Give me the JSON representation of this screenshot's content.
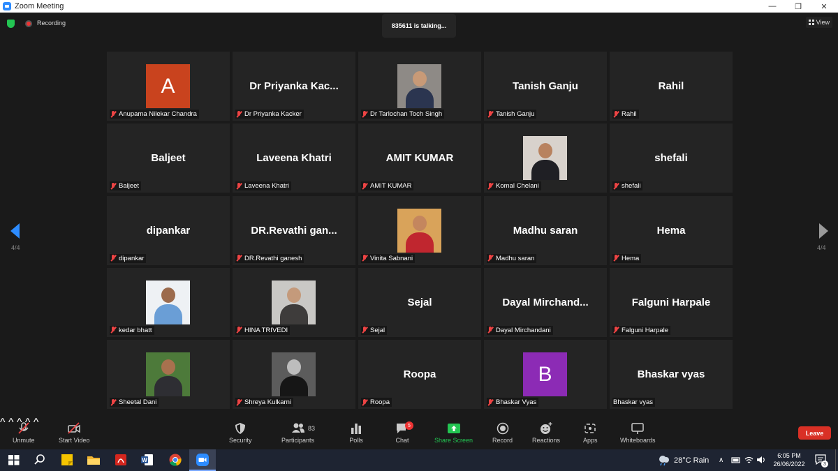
{
  "window": {
    "title": "Zoom Meeting",
    "minimize": "—",
    "restore": "❐",
    "close": "✕"
  },
  "topbar": {
    "recording_label": "Recording",
    "talking_text": "835611 is talking...",
    "view_label": "View"
  },
  "pagination": {
    "left_page": "4/4",
    "right_page": "4/4"
  },
  "participants": [
    {
      "tile": "",
      "label": "Anupama Nilekar Chandra",
      "avatar": "letter",
      "letter": "A",
      "color": "#c9431e",
      "muted": true
    },
    {
      "tile": "Dr Priyanka Kac...",
      "label": "Dr Priyanka Kacker",
      "avatar": "none",
      "muted": true
    },
    {
      "tile": "",
      "label": "Dr Tarlochan Toch Singh",
      "avatar": "photo",
      "bg": "#8e8a86",
      "skin": "#c89a77",
      "cloth": "#2b3550",
      "muted": true
    },
    {
      "tile": "Tanish Ganju",
      "label": "Tanish Ganju",
      "avatar": "none",
      "muted": true
    },
    {
      "tile": "Rahil",
      "label": "Rahil",
      "avatar": "none",
      "muted": true
    },
    {
      "tile": "Baljeet",
      "label": "Baljeet",
      "avatar": "none",
      "muted": true
    },
    {
      "tile": "Laveena Khatri",
      "label": "Laveena Khatri",
      "avatar": "none",
      "muted": true
    },
    {
      "tile": "AMIT KUMAR",
      "label": "AMIT KUMAR",
      "avatar": "none",
      "muted": true
    },
    {
      "tile": "",
      "label": "Komal Chelani",
      "avatar": "photo",
      "bg": "#d8d2cc",
      "skin": "#b8825f",
      "cloth": "#1f1f24",
      "muted": true
    },
    {
      "tile": "shefali",
      "label": "shefali",
      "avatar": "none",
      "muted": true
    },
    {
      "tile": "dipankar",
      "label": "dipankar",
      "avatar": "none",
      "muted": true
    },
    {
      "tile": "DR.Revathi  gan...",
      "label": "DR.Revathi ganesh",
      "avatar": "none",
      "muted": true
    },
    {
      "tile": "",
      "label": "Vinita Sabnani",
      "avatar": "photo",
      "bg": "#d9a35a",
      "skin": "#c4865e",
      "cloth": "#c0262f",
      "muted": true
    },
    {
      "tile": "Madhu saran",
      "label": "Madhu saran",
      "avatar": "none",
      "muted": true
    },
    {
      "tile": "Hema",
      "label": "Hema",
      "avatar": "none",
      "muted": true
    },
    {
      "tile": "",
      "label": "kedar bhatt",
      "avatar": "photo",
      "bg": "#eef1f4",
      "skin": "#9c6b4d",
      "cloth": "#6a9ed6",
      "muted": true
    },
    {
      "tile": "",
      "label": "HINA TRIVEDI",
      "avatar": "photo",
      "bg": "#c9c8c5",
      "skin": "#c49a7b",
      "cloth": "#3e3c3b",
      "muted": true
    },
    {
      "tile": "Sejal",
      "label": "Sejal",
      "avatar": "none",
      "muted": true
    },
    {
      "tile": "Dayal  Mirchand...",
      "label": "Dayal Mirchandani",
      "avatar": "none",
      "muted": true
    },
    {
      "tile": "Falguni Harpale",
      "label": "Falguni Harpale",
      "avatar": "none",
      "muted": true
    },
    {
      "tile": "",
      "label": "Sheetal Dani",
      "avatar": "photo",
      "bg": "#4d7a3a",
      "skin": "#a8714e",
      "cloth": "#2e2e33",
      "muted": true
    },
    {
      "tile": "",
      "label": "Shreya Kulkarni",
      "avatar": "photo",
      "bg": "#5c5c5c",
      "skin": "#bdbdbd",
      "cloth": "#161616",
      "muted": true
    },
    {
      "tile": "Roopa",
      "label": "Roopa",
      "avatar": "none",
      "muted": true
    },
    {
      "tile": "",
      "label": "Bhaskar Vyas",
      "avatar": "letter",
      "letter": "B",
      "color": "#8c2bb5",
      "muted": true
    },
    {
      "tile": "Bhaskar vyas",
      "label": "Bhaskar vyas",
      "avatar": "none",
      "muted": false
    }
  ],
  "toolbar": {
    "unmute": "Unmute",
    "start_video": "Start Video",
    "security": "Security",
    "participants": "Participants",
    "participants_count": "83",
    "polls": "Polls",
    "chat": "Chat",
    "chat_badge": "5",
    "share_screen": "Share Screen",
    "record": "Record",
    "reactions": "Reactions",
    "apps": "Apps",
    "whiteboards": "Whiteboards",
    "leave": "Leave",
    "caret": "^"
  },
  "taskbar": {
    "weather": "28°C  Rain",
    "time": "6:05 PM",
    "date": "26/06/2022",
    "notifications": "3"
  }
}
